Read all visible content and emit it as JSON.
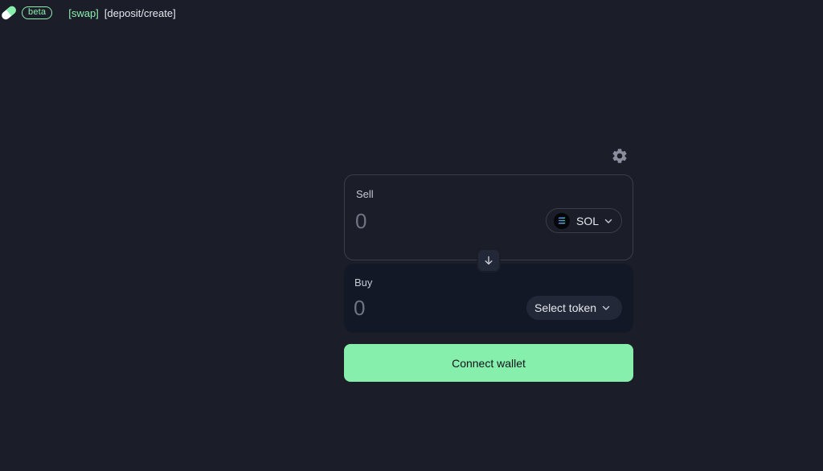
{
  "header": {
    "badge": "beta",
    "nav": [
      {
        "label": "[swap]"
      },
      {
        "label": "[deposit/create]"
      }
    ]
  },
  "swap": {
    "settings_icon": "gear-icon",
    "sell": {
      "label": "Sell",
      "amount_placeholder": "0",
      "token": "SOL"
    },
    "direction_icon": "arrow-down-icon",
    "buy": {
      "label": "Buy",
      "amount_placeholder": "0",
      "token_button": "Select token"
    },
    "connect_label": "Connect wallet"
  },
  "colors": {
    "background": "#1b1d28",
    "accent": "#86efac",
    "buy_panel": "#131827"
  }
}
